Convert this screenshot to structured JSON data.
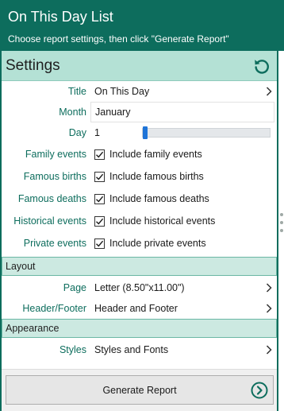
{
  "header": {
    "title": "On This Day List",
    "subtitle": "Choose report settings, then click \"Generate Report\""
  },
  "settings": {
    "heading": "Settings",
    "reset_icon": "refresh-icon",
    "title_label": "Title",
    "title_value": "On This Day",
    "month_label": "Month",
    "month_value": "January",
    "day_label": "Day",
    "day_value": "1",
    "day_slider_fraction": 0.0,
    "family_label": "Family events",
    "family_text": "Include family events",
    "family_checked": true,
    "births_label": "Famous births",
    "births_text": "Include famous births",
    "births_checked": true,
    "deaths_label": "Famous deaths",
    "deaths_text": "Include famous deaths",
    "deaths_checked": true,
    "historical_label": "Historical events",
    "historical_text": "Include historical events",
    "historical_checked": true,
    "private_label": "Private events",
    "private_text": "Include private events",
    "private_checked": true
  },
  "layout": {
    "heading": "Layout",
    "page_label": "Page",
    "page_value": "Letter (8.50\"x11.00\")",
    "headerfooter_label": "Header/Footer",
    "headerfooter_value": "Header and Footer"
  },
  "appearance": {
    "heading": "Appearance",
    "styles_label": "Styles",
    "styles_value": "Styles and Fonts"
  },
  "footer": {
    "generate_label": "Generate Report",
    "generate_icon": "arrow-right-circle-icon"
  },
  "colors": {
    "header_bg": "#0d6d5d",
    "label_text": "#0d6d5d",
    "section_bg": "#b4e1d5",
    "slider_thumb": "#1e74d8"
  }
}
